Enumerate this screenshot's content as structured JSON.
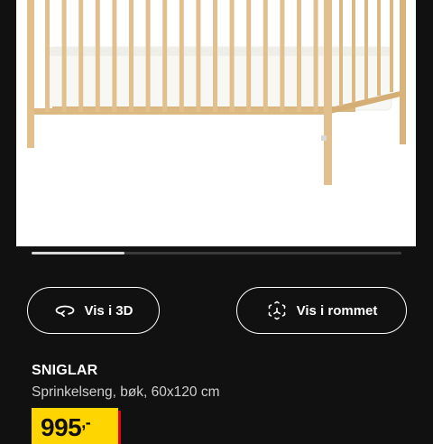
{
  "product_image": {
    "alt": "crib-photo"
  },
  "carousel": {
    "progress_fraction": 0.25
  },
  "actions": {
    "view_3d_label": "Vis i 3D",
    "view_in_room_label": "Vis i rommet"
  },
  "product": {
    "name": "SNIGLAR",
    "description": "Sprinkelseng, bøk, 60x120 cm",
    "price": "995",
    "price_suffix": ",-"
  },
  "colors": {
    "background": "#111111",
    "price_badge": "#ffd500",
    "price_badge_shadow": "#e3001b",
    "wood": "#e2c08d"
  },
  "icons": {
    "view_3d": "rotate-3d-icon",
    "view_in_room": "ar-cube-icon"
  }
}
